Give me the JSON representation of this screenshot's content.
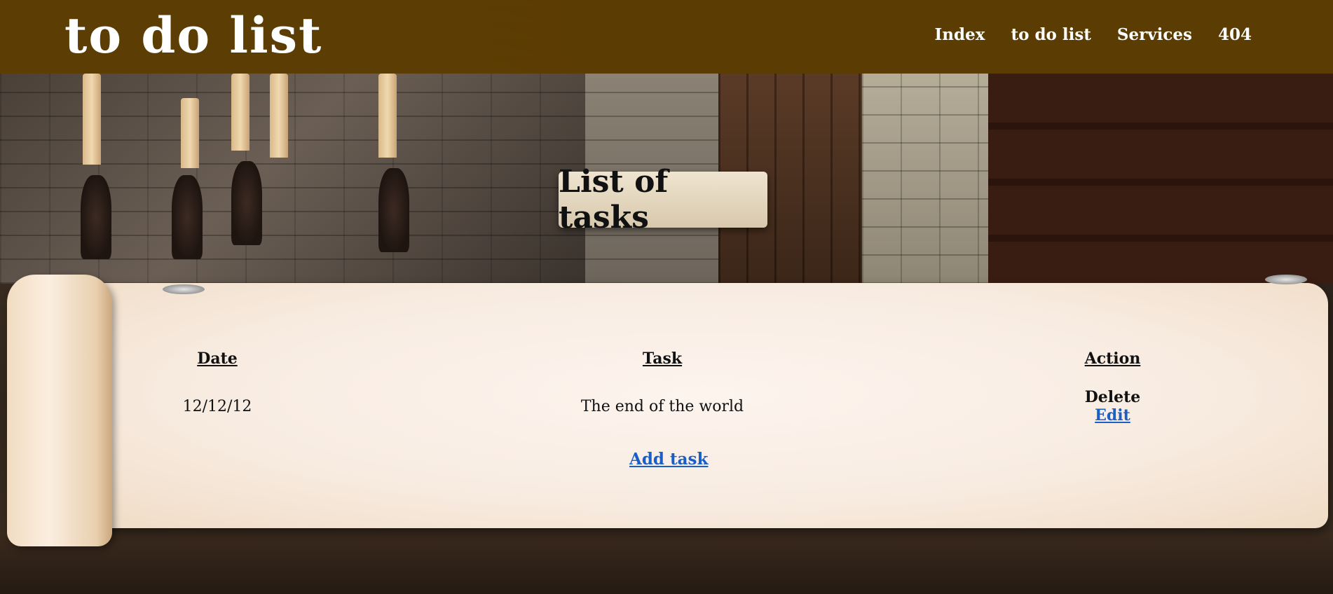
{
  "header": {
    "site_title": "to do list",
    "nav": [
      {
        "label": "Index"
      },
      {
        "label": "to do list"
      },
      {
        "label": "Services"
      },
      {
        "label": "404"
      }
    ]
  },
  "main": {
    "banner_title": "List of tasks",
    "table": {
      "columns": [
        "Date",
        "Task",
        "Action"
      ],
      "rows": [
        {
          "date": "12/12/12",
          "task": "The end of the world",
          "actions": {
            "delete": "Delete",
            "edit": "Edit"
          }
        }
      ]
    },
    "add_task_label": "Add task"
  },
  "colors": {
    "header_bg": "#5e3e00",
    "link": "#1a5fc8",
    "parchment": "#f8ece2"
  }
}
